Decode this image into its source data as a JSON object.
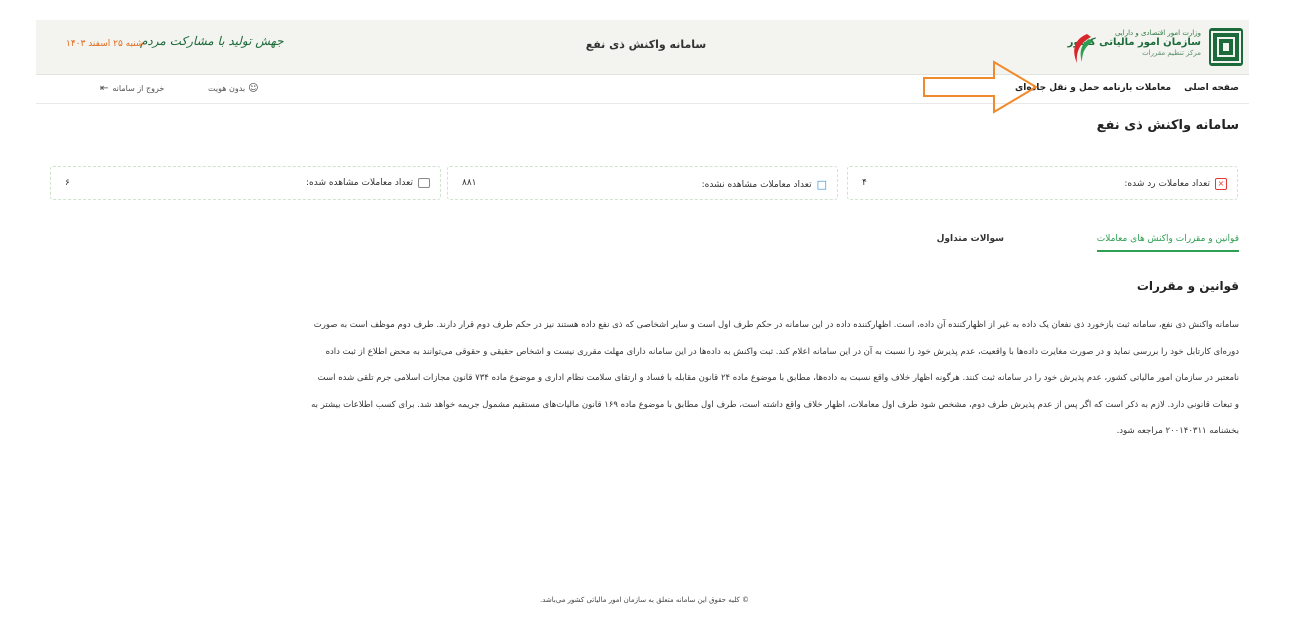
{
  "header": {
    "org_line1": "وزارت امور اقتصادی و دارایی",
    "org_line2": "سازمان امور مالیاتی کشور",
    "org_line3": "مرکز تنظیم مقررات",
    "title": "سامانه واکنش ذی نفع",
    "motto": "جهش تولید با مشارکت مردم",
    "date": "شنبه ۲۵ اسفند ۱۴۰۳"
  },
  "topbar": {
    "breadcrumb_home": "صفحه اصلی",
    "breadcrumb_current": "معاملات بارنامه حمل و نقل جاده‌ای",
    "user_label": "بدون هویت",
    "logout_label": "خروج از سامانه"
  },
  "page": {
    "title": "سامانه واکنش ذی نفع"
  },
  "cards": {
    "rejected_label": "تعداد معاملات رد شده:",
    "rejected_value": "۴",
    "unseen_label": "تعداد معاملات مشاهده نشده:",
    "unseen_value": "۸۸۱",
    "seen_label": "تعداد معاملات مشاهده شده:",
    "seen_value": "۶"
  },
  "tabs": {
    "rules": "قوانین و مقررات واکنش های معاملات",
    "faq": "سوالات متداول"
  },
  "section": {
    "title": "قوانین و مقررات",
    "lines": [
      "سامانه واکنش ذی نفع، سامانه ثبت بازخورد ذی نفعان یک داده به غیر از اظهارکننده آن داده، است. اظهارکننده داده در این سامانه در حکم طرف اول است و سایر اشخاصی که ذی نفع داده هستند نیز در حکم طرف دوم قرار دارند. طرف دوم موظف است به صورت",
      "دوره‌ای کارتابل خود را بررسی نماید و در صورت مغایرت داده‌ها با واقعیت، عدم پذیرش خود را نسبت به آن در این سامانه اعلام کند. ثبت واکنش به داده‌ها در این سامانه دارای مهلت مقرری نیست و اشخاص حقیقی و حقوقی می‌توانند به محض اطلاع از ثبت داده",
      "نامعتبر در سازمان امور مالیاتی کشور، عدم پذیرش خود را در سامانه ثبت کنند. هرگونه اظهار خلاف واقع نسبت به داده‌ها، مطابق با موضوع ماده ۲۴ قانون مقابله با فساد و ارتقای سلامت نظام اداری و موضوع ماده ۷۳۴ قانون مجازات اسلامی جرم تلقی شده است",
      "و تبعات قانونی دارد. لازم به ذکر است که اگر پس از عدم پذیرش طرف دوم، مشخص شود طرف اول معاملات، اظهار خلاف واقع داشته است، طرف اول مطابق با موضوع ماده ۱۶۹ قانون مالیات‌های مستقیم مشمول جریمه خواهد شد. برای کسب اطلاعات بیشتر به",
      "بخشنامه ۲۰۰۱۴۰۳۱۱ مراجعه شود."
    ]
  },
  "footer": {
    "text": "© کلیه حقوق این سامانه متعلق به سازمان امور مالیاتی کشور می‌باشد."
  },
  "colors": {
    "accent_green": "#2e9f52",
    "date_orange": "#e06a1e",
    "arrow_orange": "#f08a2c"
  }
}
